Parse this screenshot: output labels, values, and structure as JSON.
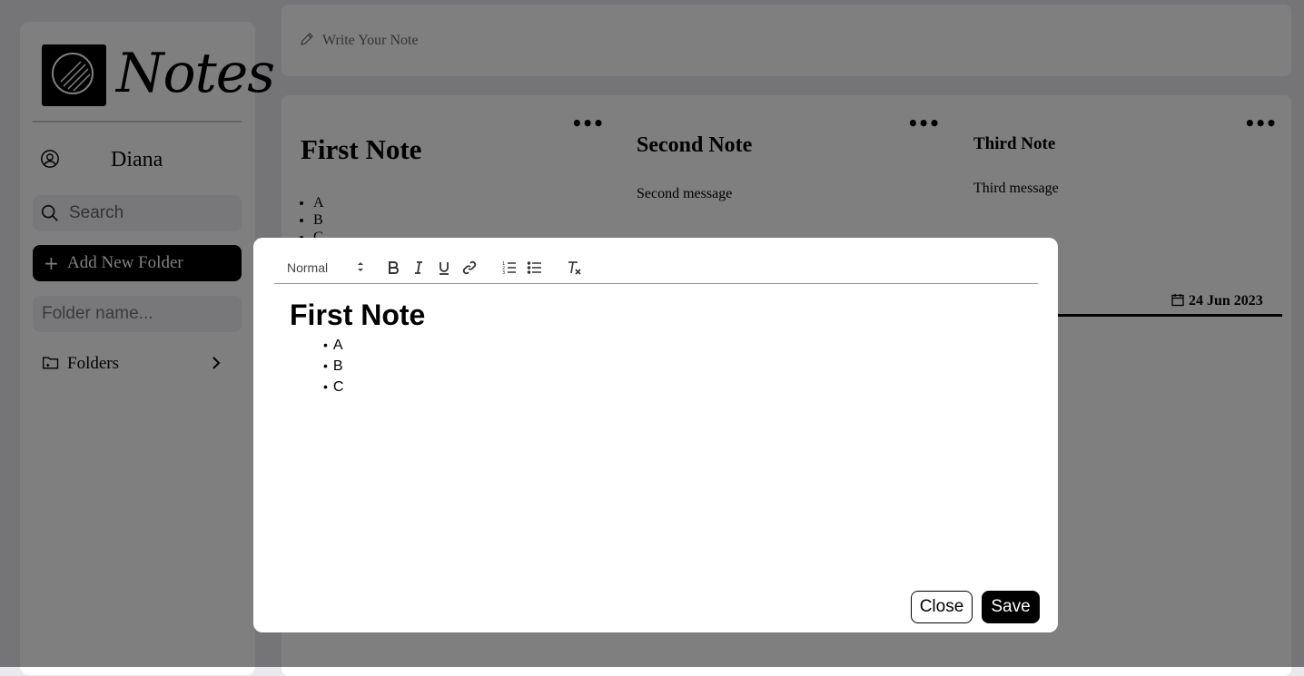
{
  "sidebar": {
    "logo_text": "Notes",
    "user_name": "Diana",
    "search_placeholder": "Search",
    "add_folder_label": "Add New Folder",
    "folder_name_placeholder": "Folder name...",
    "folders_label": "Folders"
  },
  "write_bar": {
    "placeholder": "Write Your Note"
  },
  "notes": [
    {
      "title": "First Note",
      "items": [
        "A",
        "B",
        "C"
      ]
    },
    {
      "title": "Second Note",
      "message": "Second message"
    },
    {
      "title": "Third Note",
      "message": "Third message"
    }
  ],
  "note_date": "24 Jun 2023",
  "modal": {
    "format_select": "Normal",
    "editor_heading": "First Note",
    "editor_items": [
      "A",
      "B",
      "C"
    ],
    "close_label": "Close",
    "save_label": "Save"
  },
  "icons": {
    "pencil": "pencil-icon",
    "user": "user-circle-icon",
    "search": "search-icon",
    "plus": "plus-icon",
    "folder": "folder-plus-icon",
    "chevron": "chevron-right-icon",
    "more": "more-horizontal-icon",
    "calendar": "calendar-icon",
    "bold": "bold-icon",
    "italic": "italic-icon",
    "underline": "underline-icon",
    "link": "link-icon",
    "ordered_list": "ordered-list-icon",
    "bullet_list": "bullet-list-icon",
    "clear_format": "clear-format-icon"
  },
  "colors": {
    "primary": "#000000",
    "background": "#eaeaee",
    "surface": "#ffffff",
    "overlay": "rgba(0,0,0,0.5)"
  }
}
